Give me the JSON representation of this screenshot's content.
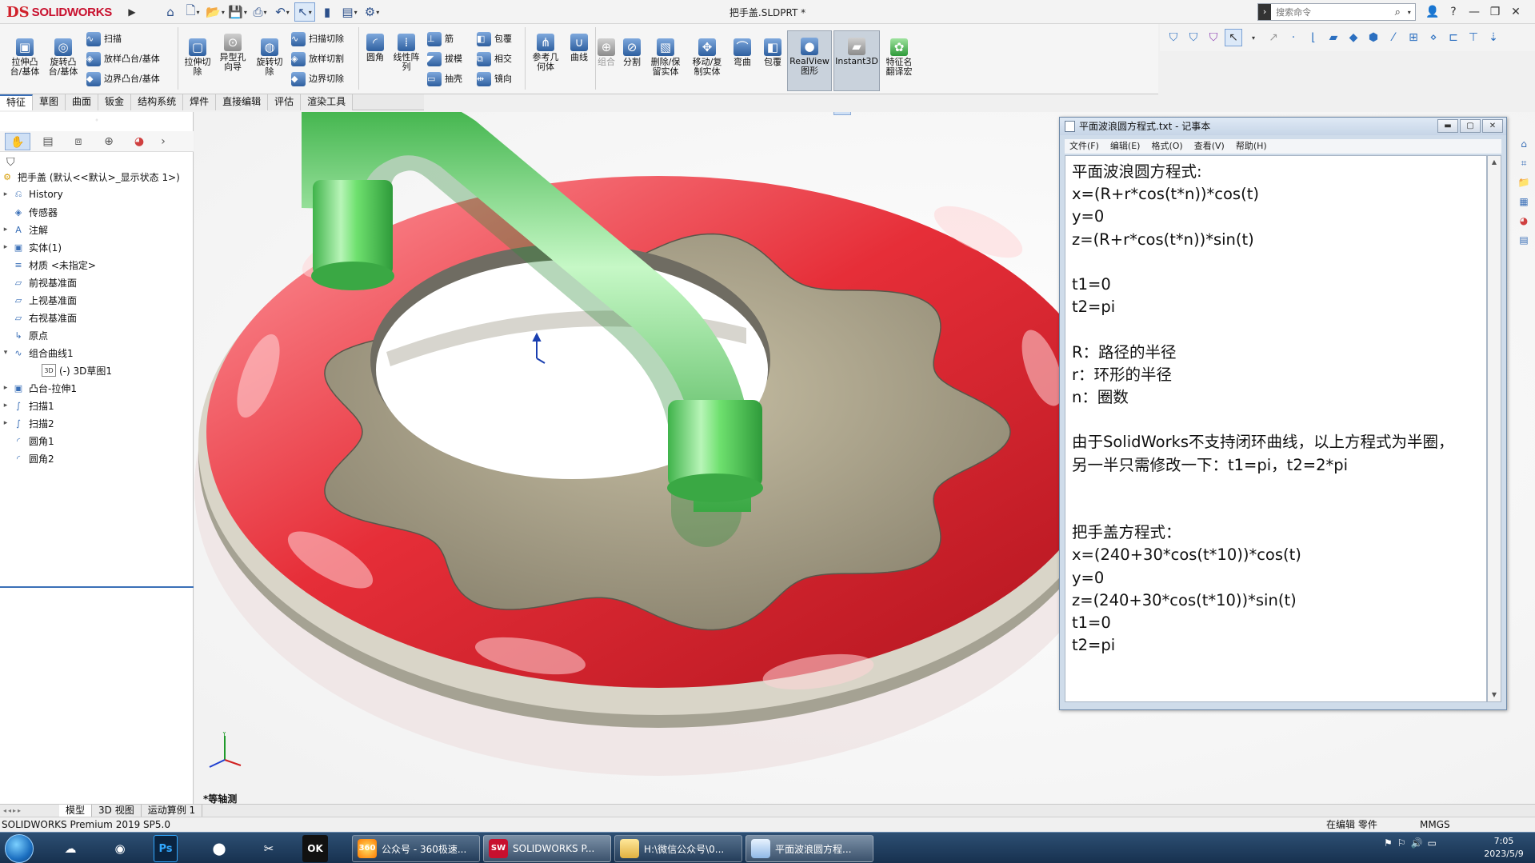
{
  "app": {
    "brand": "SOLIDWORKS",
    "brand_mark": "DS",
    "document_title": "把手盖.SLDPRT *"
  },
  "search": {
    "placeholder": "搜索命令"
  },
  "command_manager": {
    "tools": {
      "extrude_boss": "拉伸凸\n台/基体",
      "revolve_boss": "旋转凸\n台/基体",
      "sweep": "扫描",
      "loft_boss": "放样凸台/基体",
      "boundary_boss": "边界凸台/基体",
      "extrude_cut": "拉伸切\n除",
      "hole_wizard": "异型孔\n向导",
      "revolve_cut": "旋转切\n除",
      "swept_cut": "扫描切除",
      "lofted_cut": "放样切割",
      "boundary_cut": "边界切除",
      "fillet": "圆角",
      "linear_pattern": "线性阵\n列",
      "rib": "筋",
      "draft": "拔模",
      "shell": "抽壳",
      "wrap": "包覆",
      "intersect": "相交",
      "mirror": "镜向",
      "ref_geometry": "参考几\n何体",
      "curves": "曲线",
      "combine": "组合",
      "split": "分割",
      "delete_keep_body": "删除/保\n留实体",
      "move_copy_body": "移动/复\n制实体",
      "flex": "弯曲",
      "wrap2": "包覆",
      "realview": "RealView\n图形",
      "instant3d": "Instant3D",
      "feature_translate": "特征名\n翻译宏"
    },
    "tabs": [
      "特征",
      "草图",
      "曲面",
      "钣金",
      "结构系统",
      "焊件",
      "直接编辑",
      "评估",
      "渲染工具"
    ],
    "active_tab": "特征"
  },
  "feature_tree": {
    "root": "把手盖  (默认<<默认>_显示状态 1>)",
    "items": [
      {
        "label": "History",
        "expand": "▸",
        "icon": "history-icon"
      },
      {
        "label": "传感器",
        "expand": "",
        "icon": "sensor-icon"
      },
      {
        "label": "注解",
        "expand": "▸",
        "icon": "annotation-icon"
      },
      {
        "label": "实体(1)",
        "expand": "▸",
        "icon": "solid-bodies-icon"
      },
      {
        "label": "材质 <未指定>",
        "expand": "",
        "icon": "material-icon"
      },
      {
        "label": "前视基准面",
        "expand": "",
        "icon": "plane-icon"
      },
      {
        "label": "上视基准面",
        "expand": "",
        "icon": "plane-icon"
      },
      {
        "label": "右视基准面",
        "expand": "",
        "icon": "plane-icon"
      },
      {
        "label": "原点",
        "expand": "",
        "icon": "origin-icon"
      },
      {
        "label": "组合曲线1",
        "expand": "▾",
        "icon": "composite-curve-icon"
      },
      {
        "label": "(-) 3D草图1",
        "expand": "",
        "icon": "3d-sketch-icon",
        "indent": true,
        "badge": "3D"
      },
      {
        "label": "凸台-拉伸1",
        "expand": "▸",
        "icon": "boss-extrude-icon"
      },
      {
        "label": "扫描1",
        "expand": "▸",
        "icon": "sweep-icon"
      },
      {
        "label": "扫描2",
        "expand": "▸",
        "icon": "sweep-icon"
      },
      {
        "label": "圆角1",
        "expand": "",
        "icon": "fillet-icon"
      },
      {
        "label": "圆角2",
        "expand": "",
        "icon": "fillet-icon"
      }
    ]
  },
  "viewport": {
    "view_label": "*等轴测"
  },
  "notepad": {
    "title": "平面波浪圆方程式.txt - 记事本",
    "menu": [
      "文件(F)",
      "编辑(E)",
      "格式(O)",
      "查看(V)",
      "帮助(H)"
    ],
    "lines": [
      "平面波浪圆方程式:",
      "x=(R+r*cos(t*n))*cos(t)",
      "y=0",
      "z=(R+r*cos(t*n))*sin(t)",
      "",
      "t1=0",
      "t2=pi",
      "",
      "R：路径的半径",
      "r：环形的半径",
      "n：圈数",
      "",
      "由于SolidWorks不支持闭环曲线，以上方程式为半圈，",
      "另一半只需修改一下：t1=pi，t2=2*pi",
      "",
      "",
      "把手盖方程式：",
      "x=(240+30*cos(t*10))*cos(t)",
      "y=0",
      "z=(240+30*cos(t*10))*sin(t)",
      "t1=0",
      "t2=pi"
    ]
  },
  "bottom_tabs": [
    "模型",
    "3D 视图",
    "运动算例 1"
  ],
  "status": {
    "left": "SOLIDWORKS Premium 2019 SP5.0",
    "edit": "在编辑 零件",
    "units": "MMGS"
  },
  "taskbar": {
    "tasks": [
      {
        "label": "公众号 - 360极速...",
        "icon_text": "360"
      },
      {
        "label": "SOLIDWORKS P...",
        "icon_text": "SW"
      },
      {
        "label": "H:\\微信公众号\\0...",
        "icon_text": ""
      },
      {
        "label": "平面波浪圆方程...",
        "icon_text": ""
      }
    ],
    "clock_time": "7:05",
    "clock_date": "2023/5/9"
  },
  "colors": {
    "accent": "#3a6fb7",
    "brand": "#c8102e",
    "handle_green": "#5cd65c",
    "wave_red": "#e8323c"
  }
}
